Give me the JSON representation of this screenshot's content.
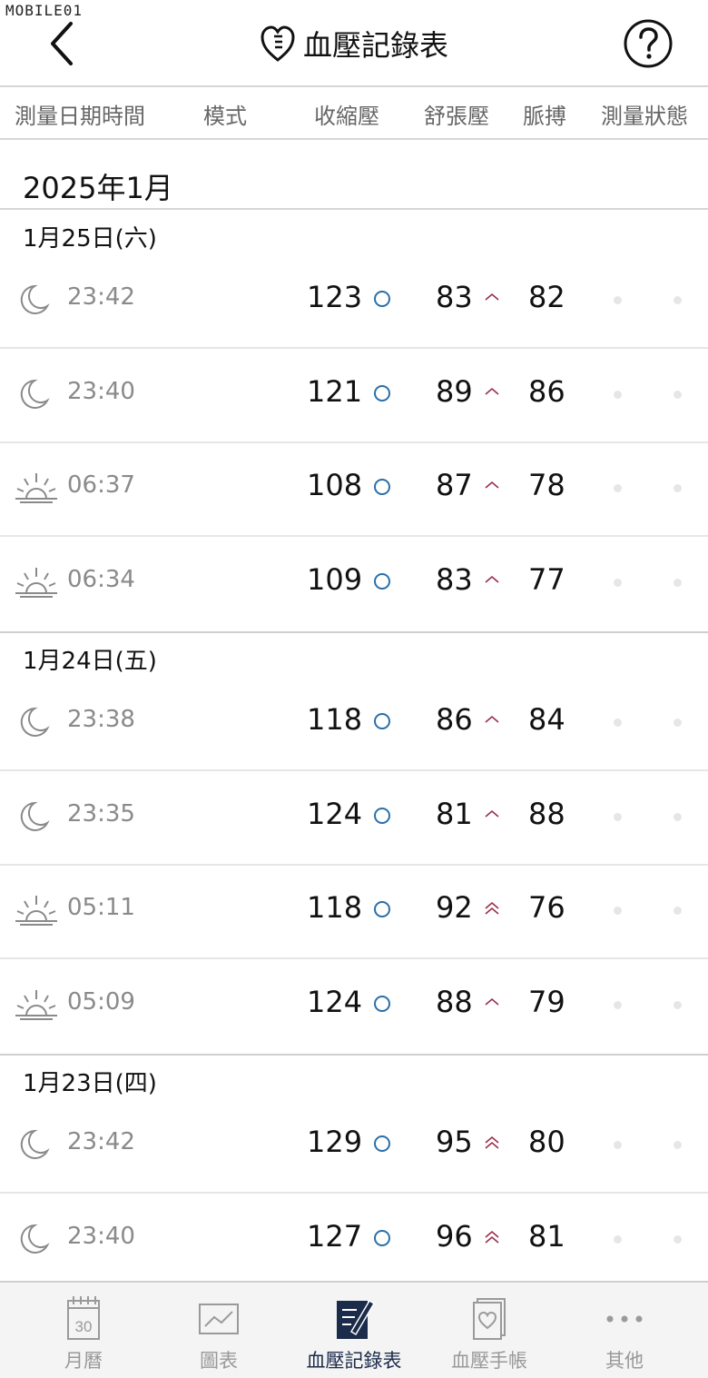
{
  "watermark": "MOBILE01",
  "header": {
    "title": "血壓記錄表"
  },
  "columns": [
    "測量日期時間",
    "模式",
    "收縮壓",
    "舒張壓",
    "脈搏",
    "測量狀態"
  ],
  "month": "2025年1月",
  "groups": [
    {
      "date": "1月25日(六)",
      "rows": [
        {
          "mode": "moon-icon",
          "time": "23:42",
          "sys": "123",
          "dia": "83",
          "pulse": "82",
          "level": 1
        },
        {
          "mode": "moon-icon",
          "time": "23:40",
          "sys": "121",
          "dia": "89",
          "pulse": "86",
          "level": 1
        },
        {
          "mode": "sunrise-icon",
          "time": "06:37",
          "sys": "108",
          "dia": "87",
          "pulse": "78",
          "level": 1
        },
        {
          "mode": "sunrise-icon",
          "time": "06:34",
          "sys": "109",
          "dia": "83",
          "pulse": "77",
          "level": 1
        }
      ]
    },
    {
      "date": "1月24日(五)",
      "rows": [
        {
          "mode": "moon-icon",
          "time": "23:38",
          "sys": "118",
          "dia": "86",
          "pulse": "84",
          "level": 1
        },
        {
          "mode": "moon-icon",
          "time": "23:35",
          "sys": "124",
          "dia": "81",
          "pulse": "88",
          "level": 1
        },
        {
          "mode": "sunrise-icon",
          "time": "05:11",
          "sys": "118",
          "dia": "92",
          "pulse": "76",
          "level": 2
        },
        {
          "mode": "sunrise-icon",
          "time": "05:09",
          "sys": "124",
          "dia": "88",
          "pulse": "79",
          "level": 1
        }
      ]
    },
    {
      "date": "1月23日(四)",
      "rows": [
        {
          "mode": "moon-icon",
          "time": "23:42",
          "sys": "129",
          "dia": "95",
          "pulse": "80",
          "level": 2
        },
        {
          "mode": "moon-icon",
          "time": "23:40",
          "sys": "127",
          "dia": "96",
          "pulse": "81",
          "level": 2
        }
      ]
    }
  ],
  "tabs": [
    {
      "label": "月曆",
      "icon": "calendar-icon",
      "calendar_day": "30",
      "active": false
    },
    {
      "label": "圖表",
      "icon": "chart-icon",
      "active": false
    },
    {
      "label": "血壓記錄表",
      "icon": "record-icon",
      "active": true
    },
    {
      "label": "血壓手帳",
      "icon": "notebook-icon",
      "active": false
    },
    {
      "label": "其他",
      "icon": "more-icon",
      "active": false
    }
  ],
  "colors": {
    "accent": "#1b2b4a",
    "normal_mark": "#2b6fa8",
    "high_mark": "#9a2d4a",
    "inactive": "#999999"
  }
}
